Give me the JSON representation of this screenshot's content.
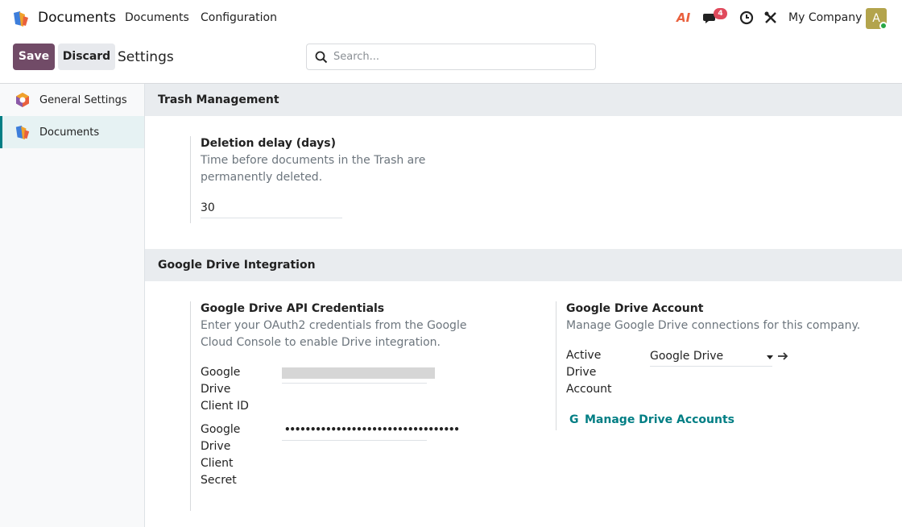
{
  "navbar": {
    "app_name": "Documents",
    "menus": [
      "Documents",
      "Configuration"
    ],
    "chat_count": "4",
    "ai_label": "AI",
    "company": "My Company",
    "avatar_letter": "A"
  },
  "control_panel": {
    "save_label": "Save",
    "discard_label": "Discard",
    "title": "Settings",
    "search_placeholder": "Search..."
  },
  "sidebar": {
    "items": [
      {
        "label": "General Settings",
        "icon": "settings-hexagon-icon",
        "active": false
      },
      {
        "label": "Documents",
        "icon": "documents-app-icon",
        "active": true
      }
    ]
  },
  "sections": {
    "trash": {
      "title": "Trash Management",
      "deletion_delay": {
        "title": "Deletion delay (days)",
        "description": "Time before documents in the Trash are permanently deleted.",
        "value": "30"
      }
    },
    "gdrive": {
      "title": "Google Drive Integration",
      "api": {
        "title": "Google Drive API Credentials",
        "description": "Enter your OAuth2 credentials from the Google Cloud Console to enable Drive integration.",
        "client_id_label": "Google Drive Client ID",
        "client_secret_label": "Google Drive Client Secret",
        "client_secret_value": "••••••••••••••••••••••••••••••••••"
      },
      "account": {
        "title": "Google Drive Account",
        "description": "Manage Google Drive connections for this company.",
        "active_label": "Active Drive Account",
        "active_value": "Google Drive",
        "manage_link": "Manage Drive Accounts",
        "g_icon_glyph": "G"
      }
    }
  },
  "colors": {
    "brand": "#714b67",
    "accent": "#017e84",
    "badge": "#e04a5c"
  }
}
